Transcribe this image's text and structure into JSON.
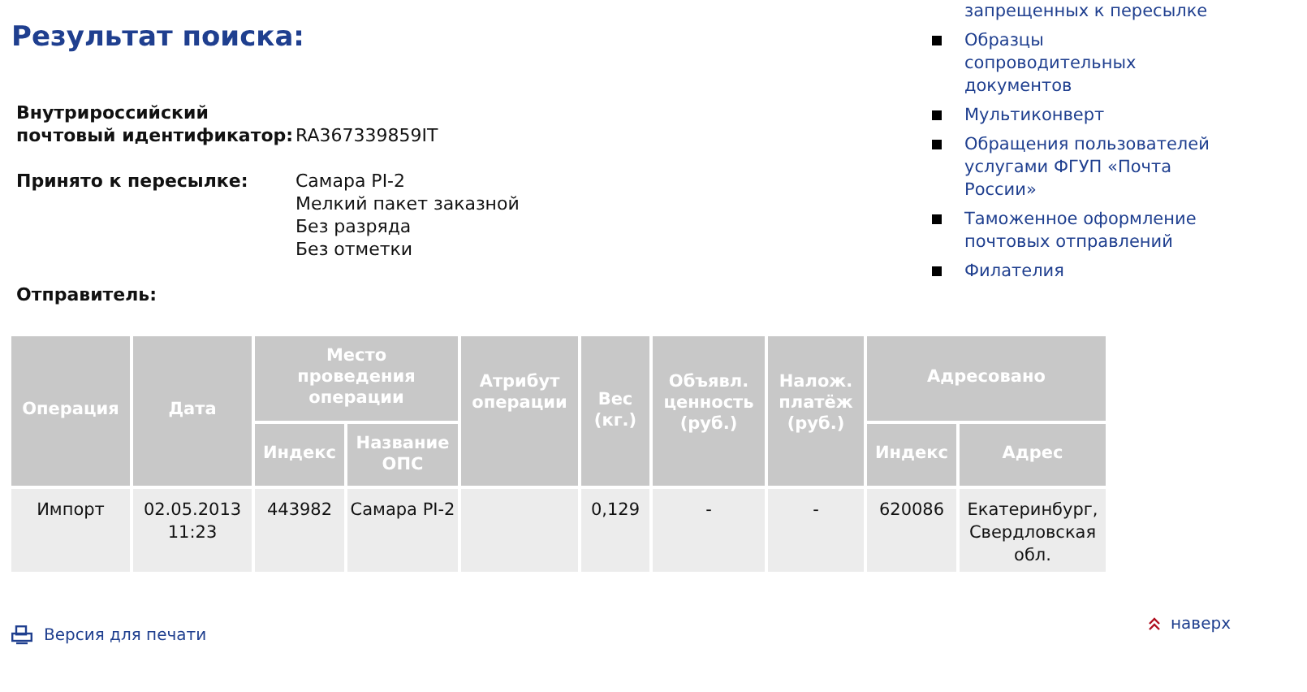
{
  "title": "Результат поиска:",
  "details": [
    {
      "label": "Внутрироссийский почтовый идентификатор:",
      "lines": [
        "RA367339859IT"
      ]
    },
    {
      "label": "Принято к пересылке:",
      "lines": [
        "Самара PI-2",
        "Мелкий пакет заказной",
        "Без разряда",
        "Без отметки"
      ]
    },
    {
      "label": "Отправитель:"
    }
  ],
  "sidebar": {
    "items": [
      "запрещенных к пересылке",
      "Образцы сопроводительных документов",
      "Мультиконверт",
      "Обращения пользователей услугами ФГУП «Почта России»",
      "Таможенное оформление почтовых отправлений",
      "Филателия"
    ]
  },
  "table": {
    "columns": [
      {
        "label": "Операция",
        "kind": "single"
      },
      {
        "label": "Дата",
        "kind": "single"
      },
      {
        "label": "Место проведения операции",
        "kind": "group",
        "colspan": 2,
        "children": [
          "Индекс",
          "Название ОПС"
        ]
      },
      {
        "label": "Атрибут операции",
        "kind": "single"
      },
      {
        "label": "Вес (кг.)",
        "kind": "single"
      },
      {
        "label": "Объявл. ценность (руб.)",
        "kind": "single"
      },
      {
        "label": "Налож. платёж (руб.)",
        "kind": "single"
      },
      {
        "label": "Адресовано",
        "kind": "group",
        "colspan": 2,
        "children": [
          "Индекс",
          "Адрес"
        ]
      }
    ],
    "rows": [
      [
        "Импорт",
        "02.05.2013 11:23",
        "443982",
        "Самара PI-2",
        "",
        "0,129",
        "-",
        "-",
        "620086",
        "Екатеринбург, Свердловская обл."
      ]
    ]
  },
  "print_link": "Версия для печати",
  "top_link": "наверх"
}
